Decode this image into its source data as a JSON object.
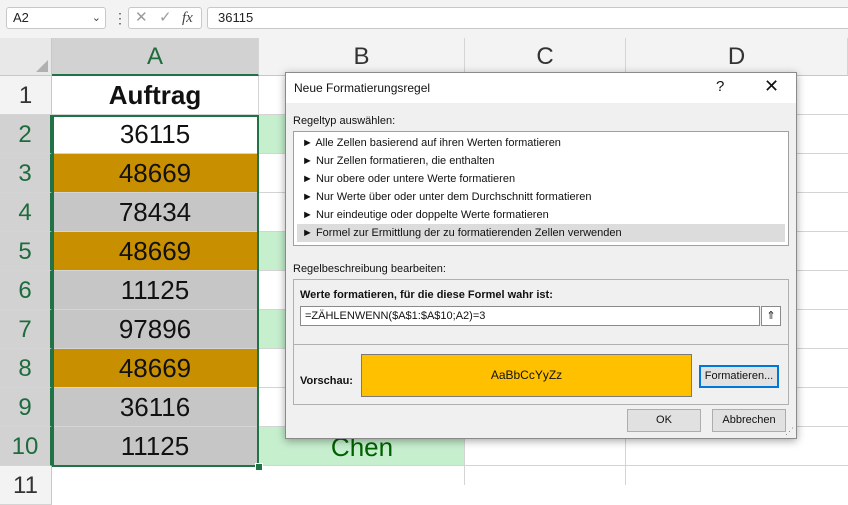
{
  "formula_bar": {
    "name_box": "A2",
    "name_box_chevron": "⌄",
    "more": "⋮",
    "cancel_icon": "✕",
    "enter_icon": "✓",
    "fx_icon": "fx",
    "value": "36115"
  },
  "columns": [
    "A",
    "B",
    "C",
    "D"
  ],
  "rows": [
    "1",
    "2",
    "3",
    "4",
    "5",
    "6",
    "7",
    "8",
    "9",
    "10",
    "11"
  ],
  "cells_a": [
    "Auftrag",
    "36115",
    "48669",
    "78434",
    "48669",
    "11125",
    "97896",
    "48669",
    "36116",
    "11125"
  ],
  "cell_b10": "Chen",
  "dialog": {
    "title": "Neue Formatierungsregel",
    "help": "?",
    "close": "✕",
    "rule_type_label": "Regeltyp auswählen:",
    "rule_types": [
      "► Alle Zellen basierend auf ihren Werten formatieren",
      "► Nur Zellen formatieren, die enthalten",
      "► Nur obere oder untere Werte formatieren",
      "► Nur Werte über oder unter dem Durchschnitt formatieren",
      "► Nur eindeutige oder doppelte Werte formatieren",
      "► Formel zur Ermittlung der zu formatierenden Zellen verwenden"
    ],
    "edit_label": "Regelbeschreibung bearbeiten:",
    "formula_label": "Werte formatieren, für die diese Formel wahr ist:",
    "formula": "=ZÄHLENWENN($A$1:$A$10;A2)=3",
    "collapse_icon": "⇑",
    "preview_label": "Vorschau:",
    "preview_text": "AaBbCcYyZz",
    "format_button": "Formatieren...",
    "ok": "OK",
    "cancel": "Abbrechen",
    "colors": {
      "preview": "#ffc000",
      "highlight_gold": "#c89000",
      "highlight_gray": "#c6c6c6",
      "green_fill": "#c6efce",
      "selection": "#217346"
    }
  }
}
